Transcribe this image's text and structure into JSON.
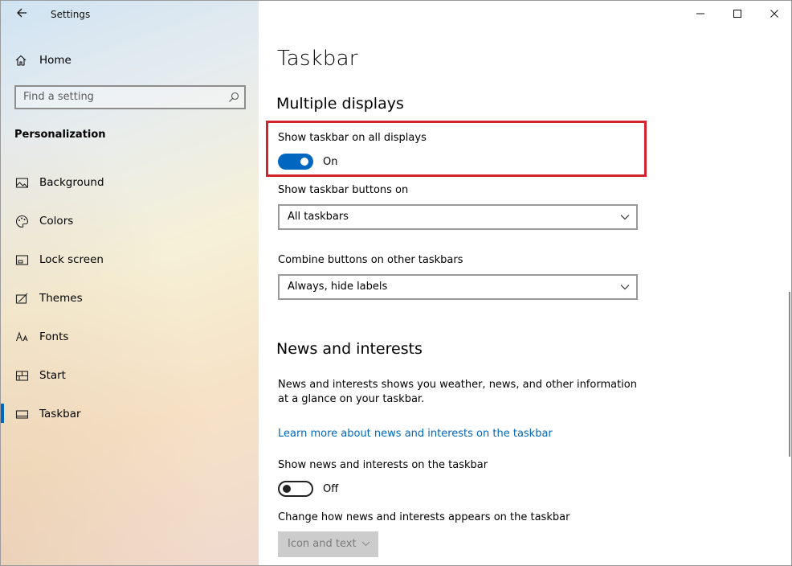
{
  "window": {
    "app_title": "Settings",
    "controls": [
      "minimize",
      "maximize",
      "close"
    ]
  },
  "sidebar": {
    "home_label": "Home",
    "search_placeholder": "Find a setting",
    "section_label": "Personalization",
    "items": [
      {
        "label": "Background",
        "icon": "picture-icon"
      },
      {
        "label": "Colors",
        "icon": "palette-icon"
      },
      {
        "label": "Lock screen",
        "icon": "lock-screen-icon"
      },
      {
        "label": "Themes",
        "icon": "themes-icon"
      },
      {
        "label": "Fonts",
        "icon": "fonts-icon"
      },
      {
        "label": "Start",
        "icon": "start-icon"
      },
      {
        "label": "Taskbar",
        "icon": "taskbar-icon",
        "selected": true
      }
    ]
  },
  "main": {
    "title": "Taskbar",
    "multiple_displays": {
      "heading": "Multiple displays",
      "show_all_label": "Show taskbar on all displays",
      "show_all_state": "On",
      "buttons_on_label": "Show taskbar buttons on",
      "buttons_on_value": "All taskbars",
      "combine_label": "Combine buttons on other taskbars",
      "combine_value": "Always, hide labels"
    },
    "news": {
      "heading": "News and interests",
      "description": "News and interests shows you weather, news, and other information at a glance on your taskbar.",
      "link": "Learn more about news and interests on the taskbar",
      "show_label": "Show news and interests on the taskbar",
      "show_state": "Off",
      "appearance_label": "Change how news and interests appears on the taskbar",
      "appearance_value": "Icon and text"
    }
  },
  "colors": {
    "accent": "#0067c0",
    "highlight_border": "#d1242f",
    "link": "#0067b8"
  }
}
